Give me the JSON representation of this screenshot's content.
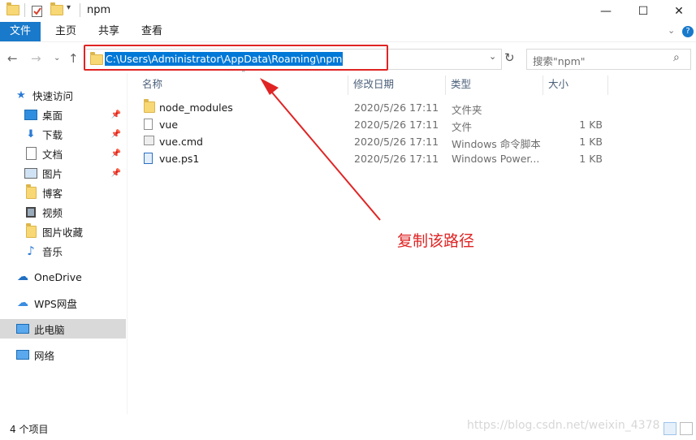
{
  "window": {
    "title": "npm"
  },
  "ribbon": {
    "tabs": [
      "文件",
      "主页",
      "共享",
      "查看"
    ]
  },
  "address": {
    "path": "C:\\Users\\Administrator\\AppData\\Roaming\\npm"
  },
  "search": {
    "placeholder": "搜索\"npm\""
  },
  "nav": {
    "quick_access": "快速访问",
    "items": [
      "桌面",
      "下载",
      "文档",
      "图片",
      "博客",
      "视频",
      "图片收藏",
      "音乐"
    ],
    "onedrive": "OneDrive",
    "wps": "WPS网盘",
    "this_pc": "此电脑",
    "network": "网络"
  },
  "columns": {
    "name": "名称",
    "modified": "修改日期",
    "type": "类型",
    "size": "大小"
  },
  "files": [
    {
      "name": "node_modules",
      "modified": "2020/5/26 17:11",
      "type": "文件夹",
      "size": "",
      "icon": "folder-icon"
    },
    {
      "name": "vue",
      "modified": "2020/5/26 17:11",
      "type": "文件",
      "size": "1 KB",
      "icon": "file-icon"
    },
    {
      "name": "vue.cmd",
      "modified": "2020/5/26 17:11",
      "type": "Windows 命令脚本",
      "size": "1 KB",
      "icon": "cmd-script-icon"
    },
    {
      "name": "vue.ps1",
      "modified": "2020/5/26 17:11",
      "type": "Windows Power...",
      "size": "1 KB",
      "icon": "powershell-script-icon"
    }
  ],
  "annotation": {
    "text": "复制该路径",
    "color": "#e02424"
  },
  "status": {
    "count": "4 个项目"
  },
  "watermark": "https://blog.csdn.net/weixin_4378",
  "colors": {
    "accent": "#1979ca",
    "selection": "#0078d7"
  }
}
